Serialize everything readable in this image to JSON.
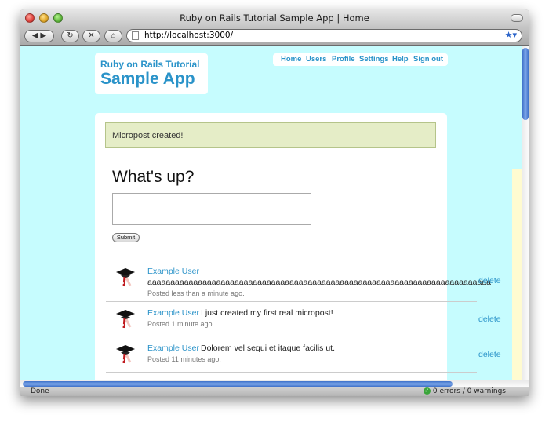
{
  "window": {
    "title": "Ruby on Rails Tutorial Sample App | Home"
  },
  "toolbar": {
    "url": "http://localhost:3000/"
  },
  "status": {
    "left_text": "Done",
    "right_text": "0 errors / 0 warnings"
  },
  "logo": {
    "line1": "Ruby on Rails Tutorial",
    "line2": "Sample App"
  },
  "nav": {
    "items": [
      {
        "label": "Home"
      },
      {
        "label": "Users"
      },
      {
        "label": "Profile"
      },
      {
        "label": "Settings"
      },
      {
        "label": "Help"
      },
      {
        "label": "Sign out"
      }
    ]
  },
  "flash": {
    "text": "Micropost created!"
  },
  "form": {
    "heading": "What's up?",
    "submit_label": "Submit"
  },
  "feed": [
    {
      "user": "Example User",
      "content": "aaaaaaaaaaaaaaaaaaaaaaaaaaaaaaaaaaaaaaaaaaaaaaaaaaaaaaaaaaaaaaaaaaaaaaaaaaa",
      "time": "Posted less than a minute ago.",
      "delete": "delete"
    },
    {
      "user": "Example User",
      "content": "I just created my first real micropost!",
      "time": "Posted 1 minute ago.",
      "delete": "delete"
    },
    {
      "user": "Example User",
      "content": "Dolorem vel sequi et itaque facilis ut.",
      "time": "Posted 11 minutes ago.",
      "delete": "delete"
    }
  ]
}
